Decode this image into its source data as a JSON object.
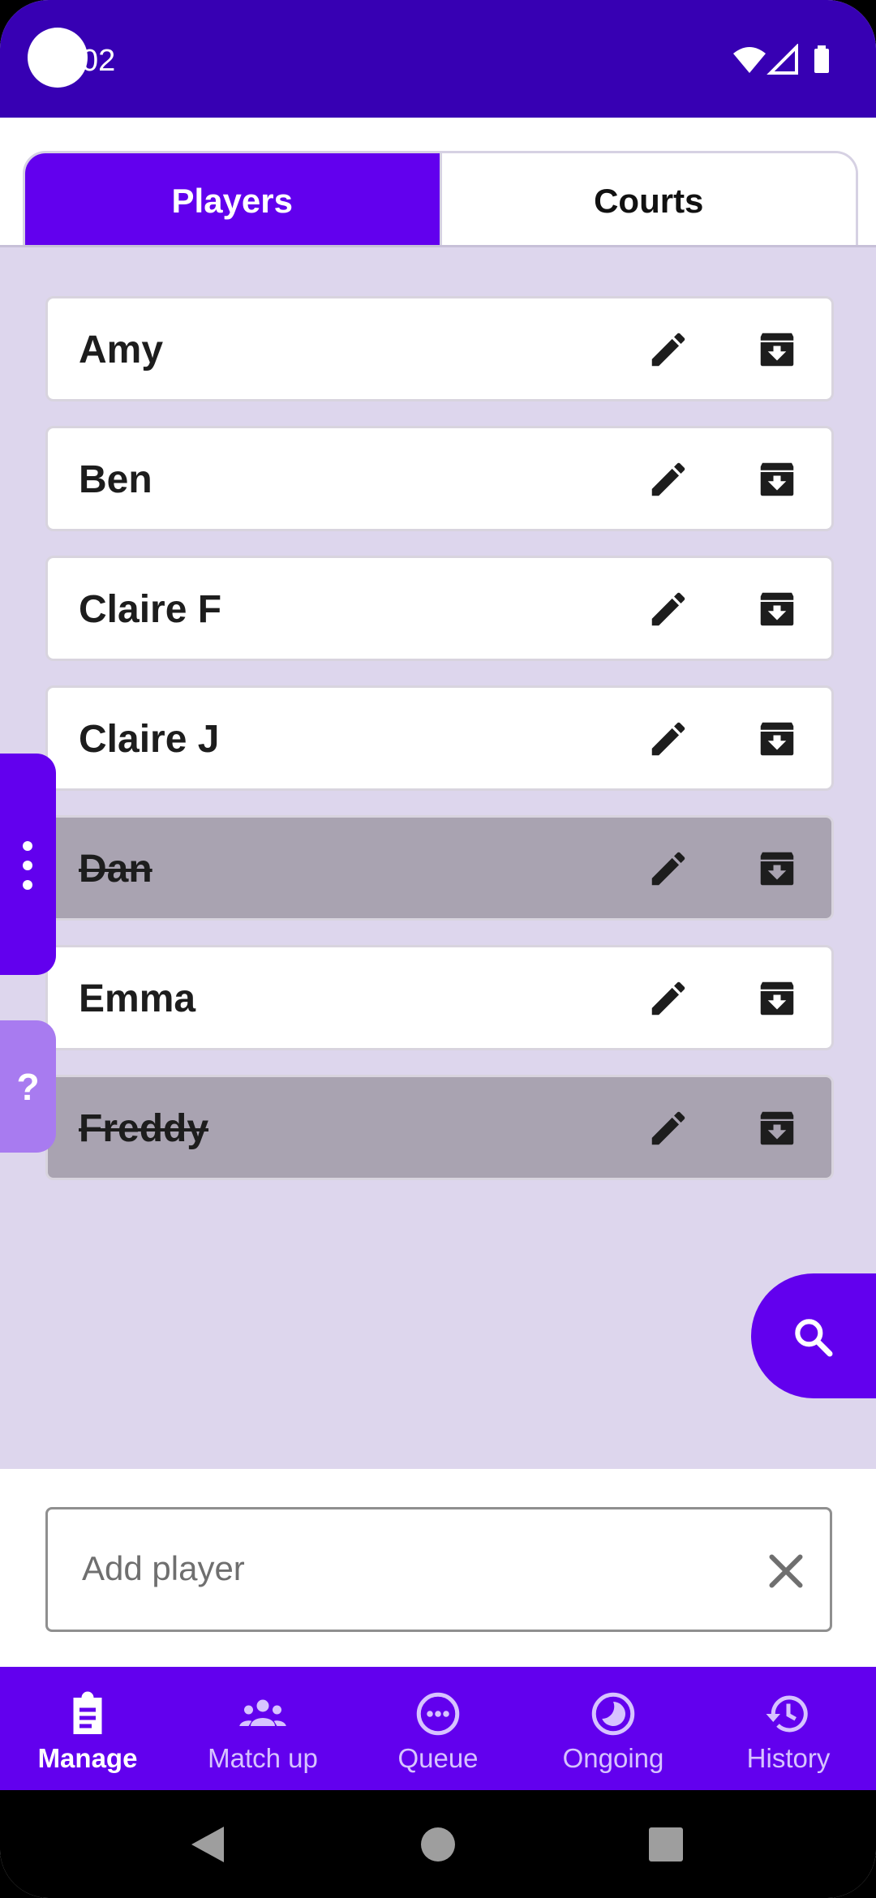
{
  "status": {
    "time": "02"
  },
  "tabs": [
    {
      "label": "Players"
    },
    {
      "label": "Courts"
    }
  ],
  "players": [
    {
      "name": "Amy",
      "disabled": false
    },
    {
      "name": "Ben",
      "disabled": false
    },
    {
      "name": "Claire F",
      "disabled": false
    },
    {
      "name": "Claire J",
      "disabled": false
    },
    {
      "name": "Dan",
      "disabled": true
    },
    {
      "name": "Emma",
      "disabled": false
    },
    {
      "name": "Freddy",
      "disabled": true
    }
  ],
  "help": {
    "label": "?"
  },
  "add_player": {
    "placeholder": "Add player",
    "value": ""
  },
  "nav": [
    {
      "label": "Manage",
      "icon": "clipboard-icon"
    },
    {
      "label": "Match up",
      "icon": "group-icon"
    },
    {
      "label": "Queue",
      "icon": "more-circle-icon"
    },
    {
      "label": "Ongoing",
      "icon": "progress-icon"
    },
    {
      "label": "History",
      "icon": "history-icon"
    }
  ],
  "colors": {
    "primary": "#6200ee",
    "status": "#3700b3",
    "content_bg": "#ddd6ed",
    "disabled_row": "#a9a3b1"
  }
}
